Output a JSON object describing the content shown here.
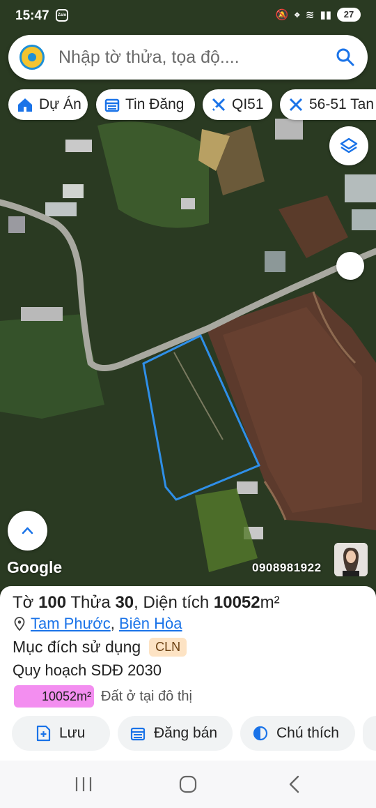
{
  "status_bar": {
    "time": "15:47",
    "app_badge": "Zalo",
    "battery": "27"
  },
  "search": {
    "placeholder": "Nhập tờ thửa, tọa độ...."
  },
  "chips": [
    {
      "label": "Dự Án",
      "icon": "home-icon"
    },
    {
      "label": "Tin Đăng",
      "icon": "calendar-icon"
    },
    {
      "label": "QI51",
      "icon": "tools-icon"
    },
    {
      "label": "56-51 Tan",
      "icon": "tools-icon"
    }
  ],
  "map": {
    "google_label": "Google",
    "phone": "0908981922",
    "parcel_outline_color": "#2f8fe8"
  },
  "parcel": {
    "sheet_label": "Tờ",
    "sheet": "100",
    "plot_label": "Thửa",
    "plot": "30",
    "area_label": ", Diện tích",
    "area": "10052",
    "area_unit": "m²",
    "location": [
      "Tam Phước",
      "Biên Hòa"
    ],
    "location_separator": ",",
    "purpose_label": "Mục đích sử dụng",
    "purpose_code": "CLN",
    "plan_title": "Quy hoạch SDĐ 2030",
    "plan_area": "10052m²",
    "plan_use": "Đất ở tại đô thị",
    "plan_color": "#f38ef0"
  },
  "actions": {
    "save": "Lưu",
    "post": "Đăng bán",
    "legend": "Chú thích"
  },
  "colors": {
    "accent": "#1a73e8",
    "badge_bg": "#fde3c4"
  }
}
